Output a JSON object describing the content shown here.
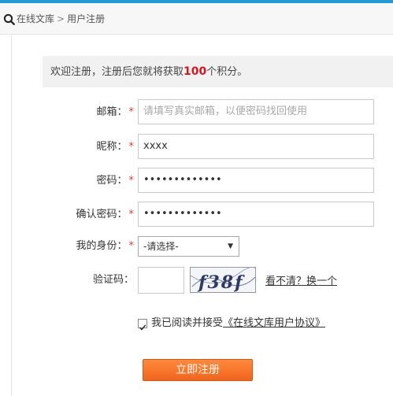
{
  "breadcrumb": {
    "site": "在线文库",
    "separator": ">",
    "current": "用户注册"
  },
  "notice": {
    "prefix": "欢迎注册，注册后您就将获取",
    "points": "100",
    "suffix": "个积分。"
  },
  "form": {
    "email": {
      "label": "邮箱：",
      "required": "*",
      "placeholder": "请填写真实邮箱，以便密码找回使用",
      "value": ""
    },
    "nickname": {
      "label": "昵称：",
      "required": "*",
      "value": "xxxx"
    },
    "password": {
      "label": "密码：",
      "required": "*",
      "value": "•••••••••••••"
    },
    "confirm_password": {
      "label": "确认密码：",
      "required": "*",
      "value": "•••••••••••••"
    },
    "identity": {
      "label": "我的身份：",
      "required": "*",
      "selected": "-请选择-"
    },
    "captcha": {
      "label": "验证码：",
      "image_text": "f38f",
      "refresh_link": "看不清？换一个",
      "value": ""
    },
    "agreement": {
      "text": "我已阅读并接受",
      "link": "《在线文库用户协议》",
      "checked": true
    },
    "submit_label": "立即注册"
  },
  "colors": {
    "accent_bar": "#1e9ad6",
    "required": "#e53b2c",
    "points": "#d9161c",
    "button": "#f2641b"
  }
}
